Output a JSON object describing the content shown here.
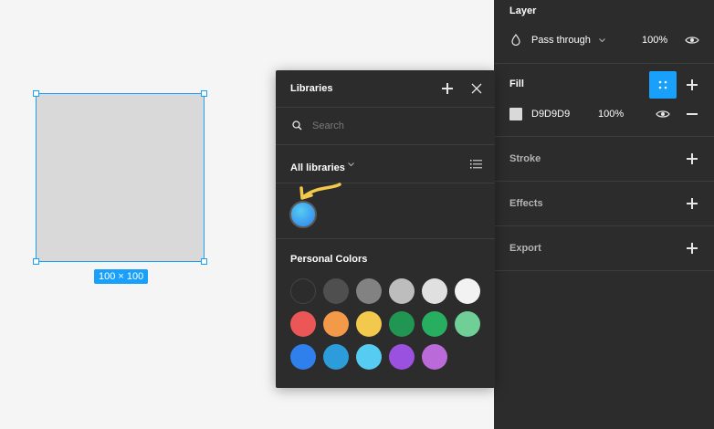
{
  "canvas": {
    "size_label": "100 × 100",
    "shape_fill": "#D9D9D9",
    "selection_color": "#18A0FB"
  },
  "props": {
    "layer": {
      "title": "Layer",
      "blend_mode": "Pass through",
      "opacity": "100%"
    },
    "fill": {
      "title": "Fill",
      "hex": "D9D9D9",
      "opacity": "100%",
      "swatch_color": "#D9D9D9"
    },
    "stroke": {
      "title": "Stroke"
    },
    "effects": {
      "title": "Effects"
    },
    "export": {
      "title": "Export"
    }
  },
  "libraries": {
    "title": "Libraries",
    "search_placeholder": "Search",
    "filter_label": "All libraries",
    "document_style_color": "#2D9CDB",
    "personal_colors_title": "Personal Colors",
    "personal_colors": [
      "#2C2C2C",
      "#4F4F4F",
      "#828282",
      "#BDBDBD",
      "#E0E0E0",
      "#F2F2F2",
      "#EB5757",
      "#F2994A",
      "#F2C94C",
      "#219653",
      "#27AE60",
      "#6FCF97",
      "#2F80ED",
      "#2D9CDB",
      "#56CCF2",
      "#9B51E0",
      "#BB6BD9"
    ],
    "arrow_color": "#F2C94C"
  }
}
